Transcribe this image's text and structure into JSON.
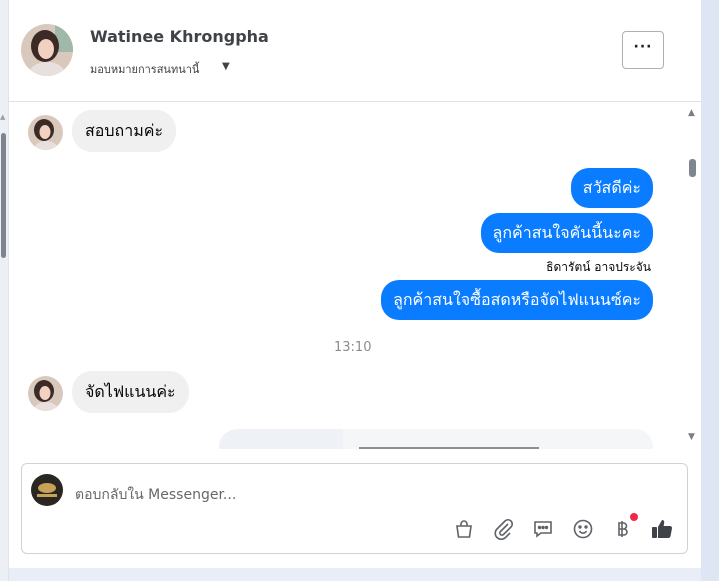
{
  "contact": {
    "name": "Watinee Khrongpha",
    "assign_label": "มอบหมายการสนทนานี้"
  },
  "header": {
    "more_label": "···"
  },
  "messages": [
    {
      "direction": "in",
      "text": "สอบถามค่ะ"
    },
    {
      "direction": "out",
      "text": "สวัสดีค่ะ"
    },
    {
      "direction": "out",
      "text": "ลูกค้าสนใจคันนี้นะคะ",
      "sender": "ธิดารัตน์ อาจประจัน"
    },
    {
      "direction": "out",
      "text": "ลูกค้าสนใจซื้อสดหรือจัดไฟแนนซ์คะ"
    },
    {
      "direction": "in",
      "text": "จัดไฟแนนค่ะ"
    }
  ],
  "timestamp": "13:10",
  "composer": {
    "placeholder": "ตอบกลับใน Messenger...",
    "tools": [
      "shopping-bag-icon",
      "paperclip-icon",
      "quick-reply-icon",
      "emoji-icon",
      "baht-payment-icon",
      "thumbs-up-icon"
    ]
  },
  "colors": {
    "outgoing": "#0a7cff",
    "incoming": "#f0f0f0",
    "notification": "#f02849"
  }
}
